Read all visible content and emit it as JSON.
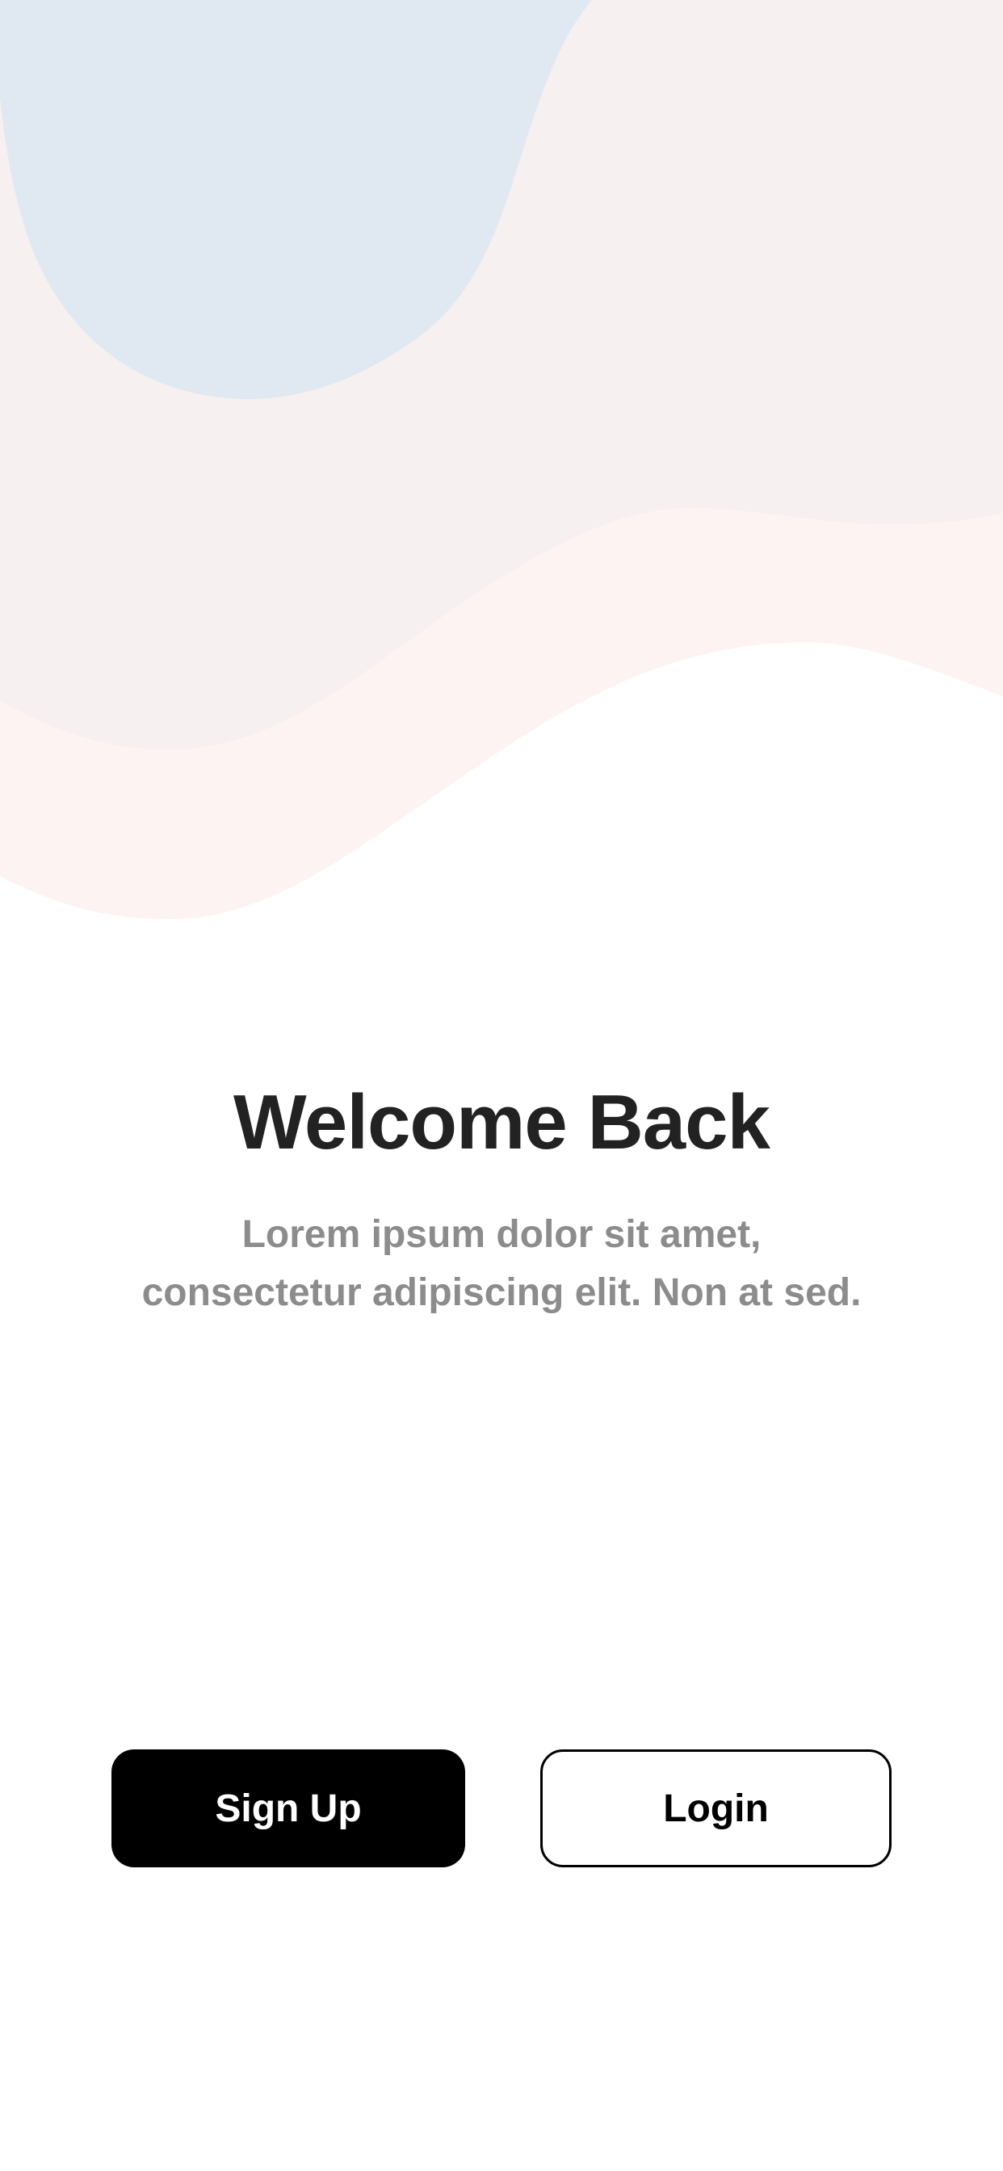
{
  "welcome": {
    "title": "Welcome Back",
    "subtitle": "Lorem ipsum dolor sit amet, consectetur adipiscing elit. Non at sed."
  },
  "actions": {
    "signup_label": "Sign Up",
    "login_label": "Login"
  },
  "colors": {
    "background": "#ffffff",
    "wave_blue": "#e0e8f1",
    "wave_pink_gray": "#f6f0f0",
    "wave_pink_light": "#fdf3f3",
    "title_text": "#222222",
    "subtitle_text": "#8c8c8c",
    "primary_button": "#000000"
  }
}
